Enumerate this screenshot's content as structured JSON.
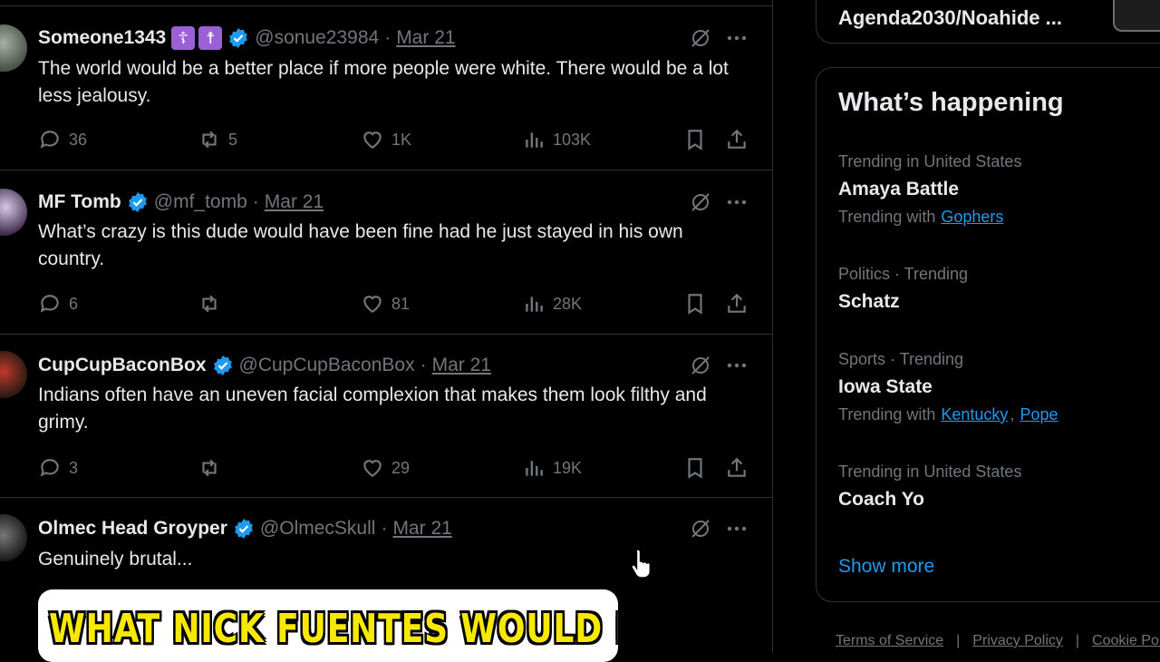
{
  "colors": {
    "accent": "#1d9bf0",
    "verified": "#1d9bf0",
    "muted": "#71767b",
    "text": "#e7e9ea",
    "background": "#000000",
    "emoji_badge": "#9b5fd6"
  },
  "tweets": [
    {
      "name": "Someone1343",
      "badges": [
        "☦",
        "☨"
      ],
      "handle": "@sonue23984",
      "separator": "·",
      "date": "Mar 21",
      "text": "The world would be a better place if more people were white. There would be a lot less jealousy.",
      "replies": "36",
      "reposts": "5",
      "likes": "1K",
      "views": "103K"
    },
    {
      "name": "MF Tomb",
      "handle": "@mf_tomb",
      "separator": "·",
      "date": "Mar 21",
      "text": "What’s crazy is this dude would have been fine had he just stayed in his own country.",
      "replies": "6",
      "reposts": "",
      "likes": "81",
      "views": "28K"
    },
    {
      "name": "CupCupBaconBox",
      "handle": "@CupCupBaconBox",
      "separator": "·",
      "date": "Mar 21",
      "text": "Indians often have an uneven facial complexion that makes them look filthy and grimy.",
      "replies": "3",
      "reposts": "",
      "likes": "29",
      "views": "19K"
    },
    {
      "name": "Olmec Head Groyper",
      "handle": "@OlmecSkull",
      "separator": "·",
      "date": "Mar 21",
      "text": "Genuinely brutal...",
      "media_caption": "WHAT NICK FUENTES WOULD LOOK"
    }
  ],
  "sidebar": {
    "top_item_title": "Agenda2030/Noahide ...",
    "heading": "What’s happening",
    "trends": [
      {
        "context": "Trending in United States",
        "name": "Amaya Battle",
        "with_label": "Trending with",
        "with": [
          "Gophers"
        ]
      },
      {
        "context": "Politics · Trending",
        "name": "Schatz"
      },
      {
        "context": "Sports · Trending",
        "name": "Iowa State",
        "with_label": "Trending with",
        "with": [
          "Kentucky",
          "Pope"
        ]
      },
      {
        "context": "Trending in United States",
        "name": "Coach Yo"
      }
    ],
    "show_more": "Show more"
  },
  "footer": {
    "links": [
      "Terms of Service",
      "Privacy Policy",
      "Cookie Pol"
    ],
    "separator": "|"
  }
}
